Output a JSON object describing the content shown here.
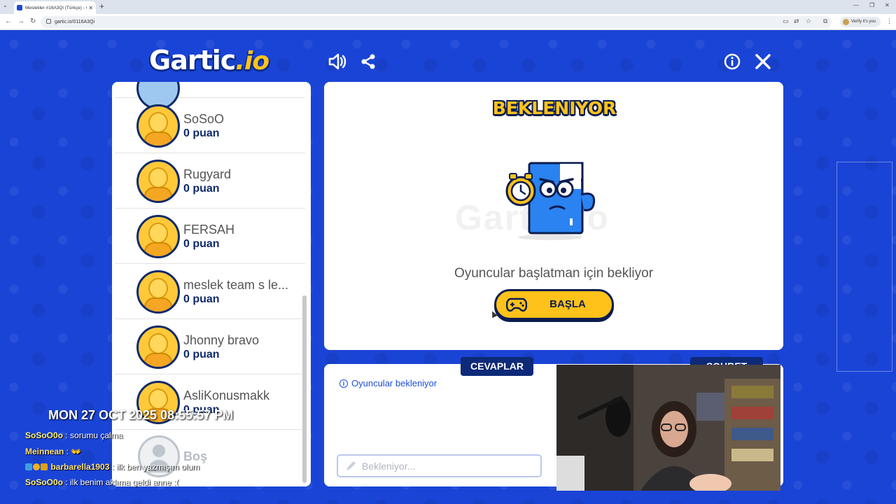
{
  "browser": {
    "tab_title": "Meslekler #16A3Qi (Türkçe) - Ga",
    "url": "gartic.io/0116A3Qi",
    "profile_label": "Verify it's you"
  },
  "logo": {
    "text": "Gartic",
    "suffix": ".io"
  },
  "players": [
    {
      "name": "SoSoO",
      "score": "0 puan"
    },
    {
      "name": "Rugyard",
      "score": "0 puan"
    },
    {
      "name": "FERSAH",
      "score": "0 puan"
    },
    {
      "name": "meslek team s le...",
      "score": "0 puan"
    },
    {
      "name": "Jhonny bravo",
      "score": "0 puan"
    },
    {
      "name": "AsliKonusmakk",
      "score": "0 puan"
    }
  ],
  "empty_slot": {
    "label": "Boş"
  },
  "main": {
    "status": "BEKLENIYOR",
    "watermark": "Gartic.io",
    "message": "Oyuncular başlatman için bekliyor",
    "start_button": "BAŞLA"
  },
  "answers": {
    "tab_answers": "CEVAPLAR",
    "tab_chat": "SOHBET",
    "info": "Oyuncular bekleniyor",
    "input_placeholder": "Bekleniyor..."
  },
  "overlay": {
    "datetime": "MON 27 OCT 2025 08:55:57 PM",
    "chat": [
      {
        "user": "SoSoO0o",
        "text": " : sorumu çalma",
        "color": "#fff27a"
      },
      {
        "user": "Meinnean",
        "text": " : 👐",
        "color": "#ffe27a"
      },
      {
        "user": "barbarella1903",
        "text": " : ilk ben yazmışım olum",
        "color": "#ffe27a"
      },
      {
        "user": "SoSoO0o",
        "text": " : ilk benim aklıma geldi anne :(",
        "color": "#fff27a"
      }
    ]
  },
  "colors": {
    "background": "#1a44d6",
    "accent_yellow": "#ffc21a",
    "navy": "#0b1d4f"
  }
}
